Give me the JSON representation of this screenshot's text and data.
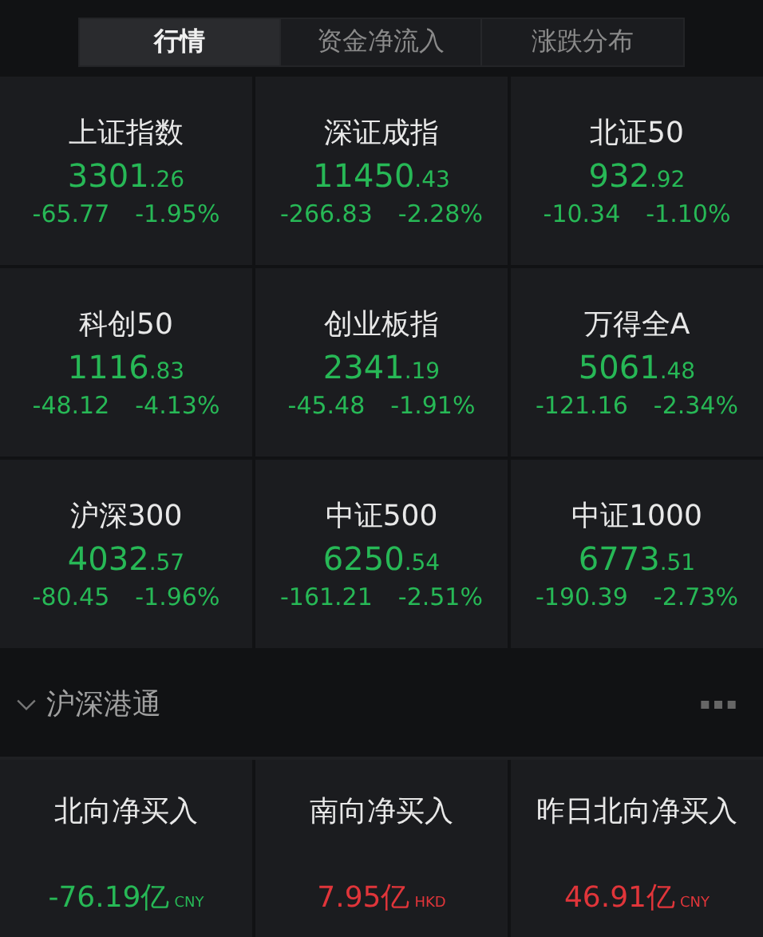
{
  "tabs": [
    {
      "label": "行情",
      "selected": true
    },
    {
      "label": "资金净流入",
      "selected": false
    },
    {
      "label": "涨跌分布",
      "selected": false
    }
  ],
  "indices": [
    {
      "name": "上证指数",
      "price_int": "3301",
      "price_dec": ".26",
      "change": "-65.77",
      "percent": "-1.95%",
      "color": "#27b856"
    },
    {
      "name": "深证成指",
      "price_int": "11450",
      "price_dec": ".43",
      "change": "-266.83",
      "percent": "-2.28%",
      "color": "#27b856"
    },
    {
      "name": "北证50",
      "price_int": "932",
      "price_dec": ".92",
      "change": "-10.34",
      "percent": "-1.10%",
      "color": "#27b856"
    },
    {
      "name": "科创50",
      "price_int": "1116",
      "price_dec": ".83",
      "change": "-48.12",
      "percent": "-4.13%",
      "color": "#27b856"
    },
    {
      "name": "创业板指",
      "price_int": "2341",
      "price_dec": ".19",
      "change": "-45.48",
      "percent": "-1.91%",
      "color": "#27b856"
    },
    {
      "name": "万得全A",
      "price_int": "5061",
      "price_dec": ".48",
      "change": "-121.16",
      "percent": "-2.34%",
      "color": "#27b856"
    },
    {
      "name": "沪深300",
      "price_int": "4032",
      "price_dec": ".57",
      "change": "-80.45",
      "percent": "-1.96%",
      "color": "#27b856"
    },
    {
      "name": "中证500",
      "price_int": "6250",
      "price_dec": ".54",
      "change": "-161.21",
      "percent": "-2.51%",
      "color": "#27b856"
    },
    {
      "name": "中证1000",
      "price_int": "6773",
      "price_dec": ".51",
      "change": "-190.39",
      "percent": "-2.73%",
      "color": "#27b856"
    }
  ],
  "section": {
    "title": "沪深港通",
    "expanded": true
  },
  "flows": [
    {
      "label": "北向净买入",
      "value": "-76.19亿",
      "currency": "CNY",
      "color": "#27b856"
    },
    {
      "label": "南向净买入",
      "value": "7.95亿",
      "currency": "HKD",
      "color": "#e0353a"
    },
    {
      "label": "昨日北向净买入",
      "value": "46.91亿",
      "currency": "CNY",
      "color": "#e0353a"
    }
  ]
}
